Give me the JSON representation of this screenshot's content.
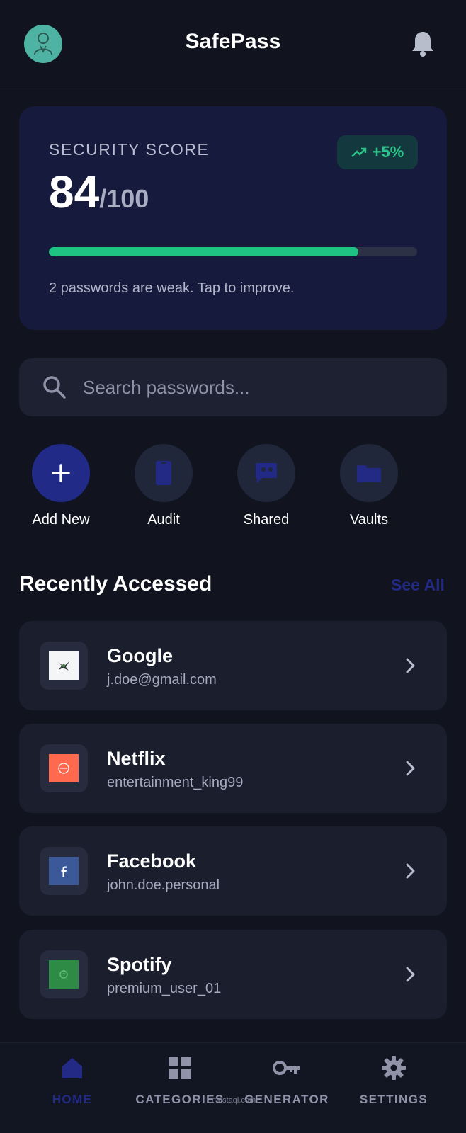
{
  "header": {
    "title": "SafePass",
    "avatar_icon": "user-avatar",
    "notification_icon": "bell-icon"
  },
  "security_score": {
    "label": "SECURITY SCORE",
    "score": "84",
    "max": "/100",
    "trend": "+5%",
    "trend_icon": "trending-up-icon",
    "progress_percent": 84,
    "hint": "2 passwords are weak. Tap to improve."
  },
  "search": {
    "placeholder": "Search passwords...",
    "value": ""
  },
  "quick_actions": [
    {
      "label": "Add New",
      "icon": "plus-icon"
    },
    {
      "label": "Audit",
      "icon": "phone-lock-icon"
    },
    {
      "label": "Shared",
      "icon": "shared-chat-icon"
    },
    {
      "label": "Vaults",
      "icon": "folder-icon"
    }
  ],
  "recent": {
    "title": "Recently Accessed",
    "see_all": "See All",
    "items": [
      {
        "name": "Google",
        "username": "j.doe@gmail.com",
        "color": "#f4f5f7"
      },
      {
        "name": "Netflix",
        "username": "entertainment_king99",
        "color": "#ff6a4f"
      },
      {
        "name": "Facebook",
        "username": "john.doe.personal",
        "color": "#3b5998"
      },
      {
        "name": "Spotify",
        "username": "premium_user_01",
        "color": "#2e8b45"
      }
    ]
  },
  "bottom_nav": [
    {
      "label": "HOME",
      "icon": "home-icon",
      "active": true
    },
    {
      "label": "CATEGORIES",
      "icon": "grid-icon",
      "active": false
    },
    {
      "label": "GENERATOR",
      "icon": "key-icon",
      "active": false
    },
    {
      "label": "SETTINGS",
      "icon": "gear-icon",
      "active": false
    }
  ],
  "watermark": "mostaql.com",
  "colors": {
    "background": "#11131f",
    "card": "#161a3c",
    "accent": "#232a86",
    "success": "#1fc283"
  }
}
